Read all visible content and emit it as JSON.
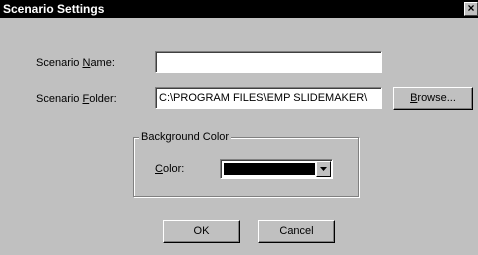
{
  "window": {
    "title": "Scenario Settings",
    "close_glyph": "×"
  },
  "fields": {
    "name": {
      "label_pre": "Scenario ",
      "label_key": "N",
      "label_post": "ame:",
      "value": ""
    },
    "folder": {
      "label_pre": "Scenario ",
      "label_key": "F",
      "label_post": "older:",
      "value": "C:\\PROGRAM FILES\\EMP SLIDEMAKER\\"
    },
    "browse": {
      "label_key": "B",
      "label_post": "rowse..."
    }
  },
  "background": {
    "legend": "Background Color",
    "color_label_key": "C",
    "color_label_post": "olor:",
    "selected_color": "#000000"
  },
  "buttons": {
    "ok": "OK",
    "cancel": "Cancel"
  },
  "icons": {
    "close": "close-icon",
    "dropdown": "chevron-down-icon"
  }
}
